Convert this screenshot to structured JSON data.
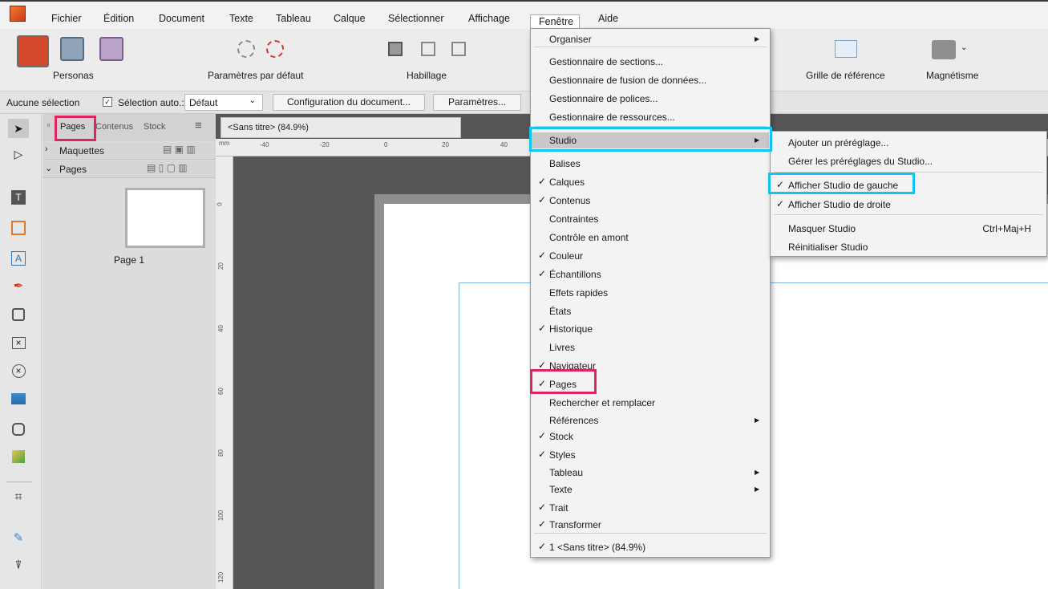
{
  "menubar": {
    "items": [
      "Fichier",
      "Édition",
      "Document",
      "Texte",
      "Tableau",
      "Calque",
      "Sélectionner",
      "Affichage",
      "Fenêtre",
      "Aide"
    ]
  },
  "toolbar": {
    "personas_label": "Personas",
    "defaults_label": "Paramètres par défaut",
    "wrap_label": "Habillage",
    "grid_label": "Grille de référence",
    "snap_label": "Magnétisme"
  },
  "context": {
    "no_selection": "Aucune sélection",
    "auto_select": "Sélection auto.:",
    "auto_select_value": "Défaut",
    "doc_setup": "Configuration du document...",
    "preferences": "Paramètres..."
  },
  "panel": {
    "tabs": [
      "Pages",
      "Contenus",
      "Stock"
    ],
    "sections": [
      "Maquettes",
      "Pages"
    ],
    "page_label": "Page 1"
  },
  "document": {
    "tab_title": "<Sans titre> (84.9%)",
    "ruler_unit": "mm",
    "ruler_h": [
      "-40",
      "-20",
      "0",
      "20",
      "40"
    ],
    "ruler_v": [
      "0",
      "20",
      "40",
      "60",
      "80",
      "100",
      "120"
    ]
  },
  "fenetre_menu": {
    "items": [
      {
        "label": "Organiser",
        "checked": false,
        "submenu": true
      },
      {
        "label": "Gestionnaire de sections...",
        "checked": false,
        "submenu": false
      },
      {
        "label": "Gestionnaire de fusion de données...",
        "checked": false,
        "submenu": false
      },
      {
        "label": "Gestionnaire de polices...",
        "checked": false,
        "submenu": false
      },
      {
        "label": "Gestionnaire de ressources...",
        "checked": false,
        "submenu": false
      },
      {
        "label": "Studio",
        "checked": false,
        "submenu": true
      },
      {
        "label": "Balises",
        "checked": false,
        "submenu": false
      },
      {
        "label": "Calques",
        "checked": true,
        "submenu": false
      },
      {
        "label": "Contenus",
        "checked": true,
        "submenu": false
      },
      {
        "label": "Contraintes",
        "checked": false,
        "submenu": false
      },
      {
        "label": "Contrôle en amont",
        "checked": false,
        "submenu": false
      },
      {
        "label": "Couleur",
        "checked": true,
        "submenu": false
      },
      {
        "label": "Échantillons",
        "checked": true,
        "submenu": false
      },
      {
        "label": "Effets rapides",
        "checked": false,
        "submenu": false
      },
      {
        "label": "États",
        "checked": false,
        "submenu": false
      },
      {
        "label": "Historique",
        "checked": true,
        "submenu": false
      },
      {
        "label": "Livres",
        "checked": false,
        "submenu": false
      },
      {
        "label": "Navigateur",
        "checked": true,
        "submenu": false
      },
      {
        "label": "Pages",
        "checked": true,
        "submenu": false
      },
      {
        "label": "Rechercher et remplacer",
        "checked": false,
        "submenu": false
      },
      {
        "label": "Références",
        "checked": false,
        "submenu": true
      },
      {
        "label": "Stock",
        "checked": true,
        "submenu": false
      },
      {
        "label": "Styles",
        "checked": true,
        "submenu": false
      },
      {
        "label": "Tableau",
        "checked": false,
        "submenu": true
      },
      {
        "label": "Texte",
        "checked": false,
        "submenu": true
      },
      {
        "label": "Trait",
        "checked": true,
        "submenu": false
      },
      {
        "label": "Transformer",
        "checked": true,
        "submenu": false
      },
      {
        "label": "1 <Sans titre> (84.9%)",
        "checked": true,
        "submenu": false
      }
    ]
  },
  "studio_submenu": {
    "items": [
      {
        "label": "Ajouter un préréglage...",
        "checked": false
      },
      {
        "label": "Gérer les préréglages du Studio...",
        "checked": false
      },
      {
        "label": "Afficher Studio de gauche",
        "checked": true
      },
      {
        "label": "Afficher Studio de droite",
        "checked": true
      },
      {
        "label": "Masquer Studio",
        "checked": false,
        "shortcut": "Ctrl+Maj+H"
      },
      {
        "label": "Réinitialiser Studio",
        "checked": false
      }
    ]
  },
  "colors": {
    "highlight_red": "#e0245e",
    "highlight_blue": "#13c3f0",
    "menu_selected": "#c8c8c8",
    "canvas": "#565656",
    "app_accent": "#e8622c"
  },
  "check_glyph": "✓",
  "arrow_glyph": "▶"
}
